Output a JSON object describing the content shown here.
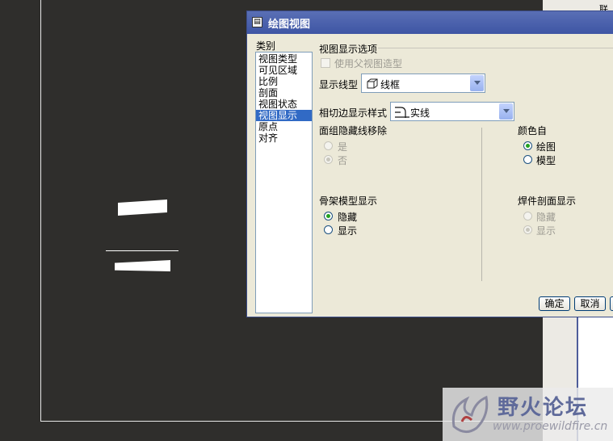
{
  "dialog": {
    "title": "绘图视图",
    "category_label": "类别",
    "categories": [
      "视图类型",
      "可见区域",
      "比例",
      "剖面",
      "视图状态",
      "视图显示",
      "原点",
      "对齐"
    ],
    "selected_category": "视图显示",
    "group_label": "视图显示选项",
    "use_parent_style": "使用父视图造型",
    "display_style_label": "显示线型",
    "display_style_value": "线框",
    "tangent_label": "相切边显示样式",
    "tangent_value": "实线",
    "hidden_line_removal": {
      "label": "面组隐藏线移除",
      "yes": "是",
      "no": "否"
    },
    "color_from": {
      "label": "颜色自",
      "drawing": "绘图",
      "model": "模型"
    },
    "skeleton_display": {
      "label": "骨架模型显示",
      "hide": "隐藏",
      "show": "显示"
    },
    "weld_section_display": {
      "label": "焊件剖面显示",
      "hide": "隐藏",
      "show": "显示"
    },
    "ok_button": "确定",
    "cancel_button": "取消"
  },
  "background": {
    "right_top_text": "联  转"
  },
  "watermark": {
    "brand": "野火论坛",
    "url": "www.proewildfire.cn"
  },
  "colors": {
    "canvas": "#2f2e2c",
    "dialog_bg": "#ece9d8",
    "title_bar": "#3e55a4",
    "selection": "#316ac5",
    "radio_dot": "#21a121"
  }
}
